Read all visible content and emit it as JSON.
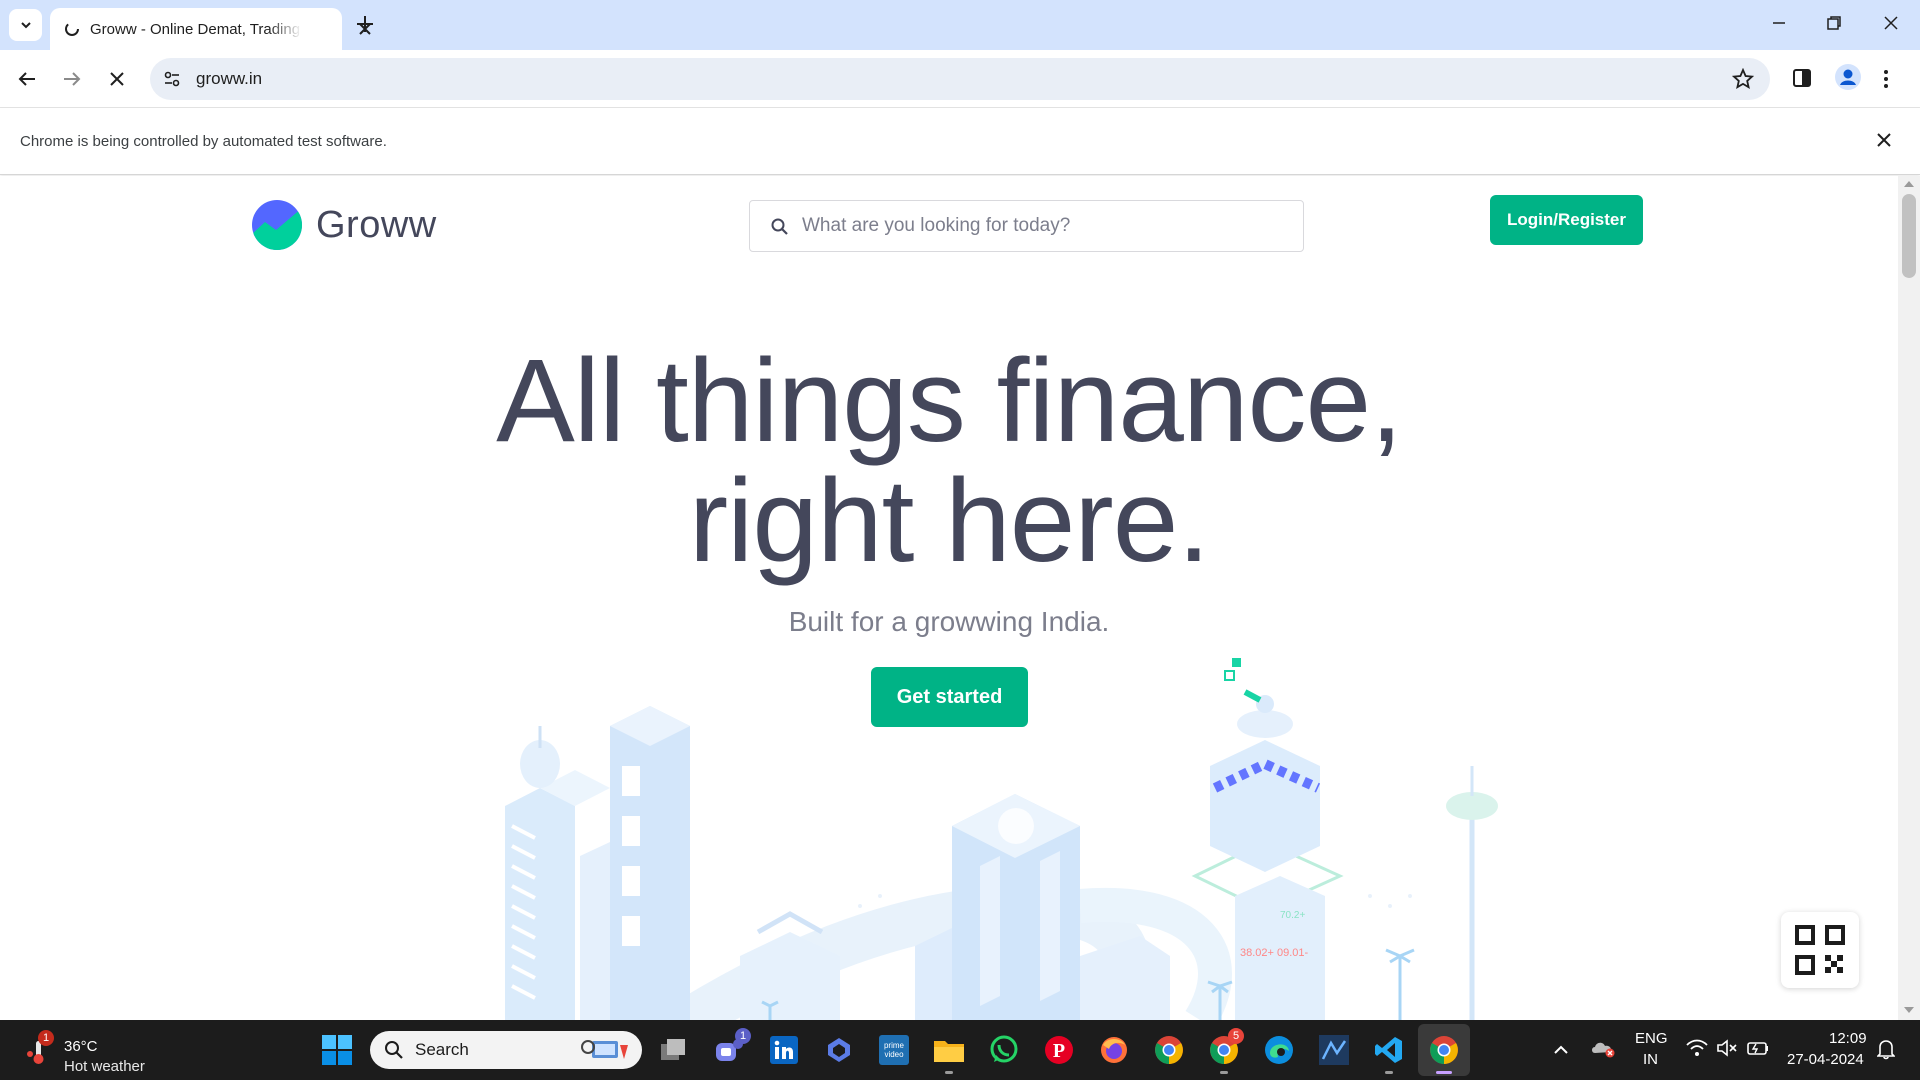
{
  "browser": {
    "tab_title": "Groww - Online Demat, Trading",
    "url": "groww.in",
    "infobar_text": "Chrome is being controlled by automated test software."
  },
  "site": {
    "logo_text": "Groww",
    "search_placeholder": "What are you looking for today?",
    "login_label": "Login/Register",
    "hero_line1": "All things finance,",
    "hero_line2": "right here.",
    "subtitle": "Built for a growwing India.",
    "cta_label": "Get started"
  },
  "colors": {
    "brand_green": "#00b386",
    "heading": "#44475b",
    "chrome_frame": "#d3e3fd"
  },
  "taskbar": {
    "weather_temp": "36°C",
    "weather_desc": "Hot weather",
    "weather_badge": "1",
    "search_label": "Search",
    "teams_badge": "1",
    "chrome_profile_badge": "5",
    "language": "ENG",
    "region": "IN",
    "time": "12:09",
    "date": "27-04-2024",
    "apps": [
      "file-explorer-icon",
      "teams-icon",
      "linkedin-icon",
      "copilot-icon",
      "prime-video-icon",
      "folder-icon",
      "whatsapp-icon",
      "pinterest-icon",
      "firefox-icon",
      "chrome-icon",
      "chrome-profile-icon",
      "edge-icon",
      "python-editor-icon",
      "vscode-icon",
      "chrome-active-icon"
    ]
  }
}
